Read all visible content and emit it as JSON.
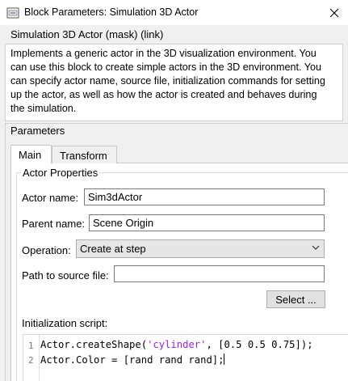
{
  "window": {
    "title": "Block Parameters: Simulation 3D Actor",
    "icon": "simulink-block-icon",
    "close_icon": "close-icon"
  },
  "mask": {
    "header": "Simulation 3D Actor (mask) (link)",
    "description_lines": [
      "Implements a generic actor in the 3D visualization environment. You",
      "can use this block to create simple actors in the 3D environment. You",
      "can specify actor name, source file, initialization commands for setting",
      "up the actor, as well as how the actor is created and behaves during",
      "the simulation."
    ]
  },
  "parameters": {
    "title": "Parameters",
    "tabs": [
      {
        "label": "Main",
        "active": true
      },
      {
        "label": "Transform",
        "active": false
      }
    ],
    "actor_properties": {
      "title": "Actor Properties",
      "actor_name_label": "Actor name:",
      "actor_name_value": "Sim3dActor",
      "parent_name_label": "Parent name:",
      "parent_name_value": "Scene Origin",
      "operation_label": "Operation:",
      "operation_value": "Create at step",
      "path_label": "Path to source file:",
      "path_value": "",
      "select_button": "Select ...",
      "init_script_label": "Initialization script:",
      "script_lines": [
        {
          "num": "1",
          "pre": "Actor.createShape(",
          "str": "'cylinder'",
          "post": ", [0.5 0.5 0.75]);"
        },
        {
          "num": "2",
          "pre": "Actor.Color = [rand rand rand];",
          "str": "",
          "post": ""
        }
      ]
    }
  }
}
